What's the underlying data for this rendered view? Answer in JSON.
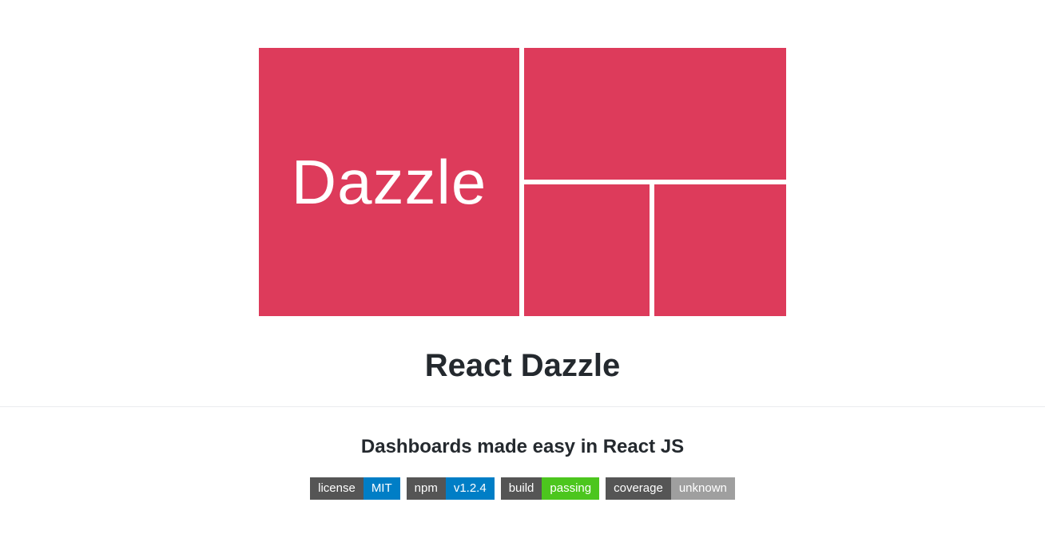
{
  "logo": {
    "text": "Dazzle",
    "color": "#dd3b5b"
  },
  "title": "React Dazzle",
  "subtitle": "Dashboards made easy in React JS",
  "badges": [
    {
      "label": "license",
      "value": "MIT",
      "color": "blue"
    },
    {
      "label": "npm",
      "value": "v1.2.4",
      "color": "blue"
    },
    {
      "label": "build",
      "value": "passing",
      "color": "green"
    },
    {
      "label": "coverage",
      "value": "unknown",
      "color": "grey"
    }
  ]
}
